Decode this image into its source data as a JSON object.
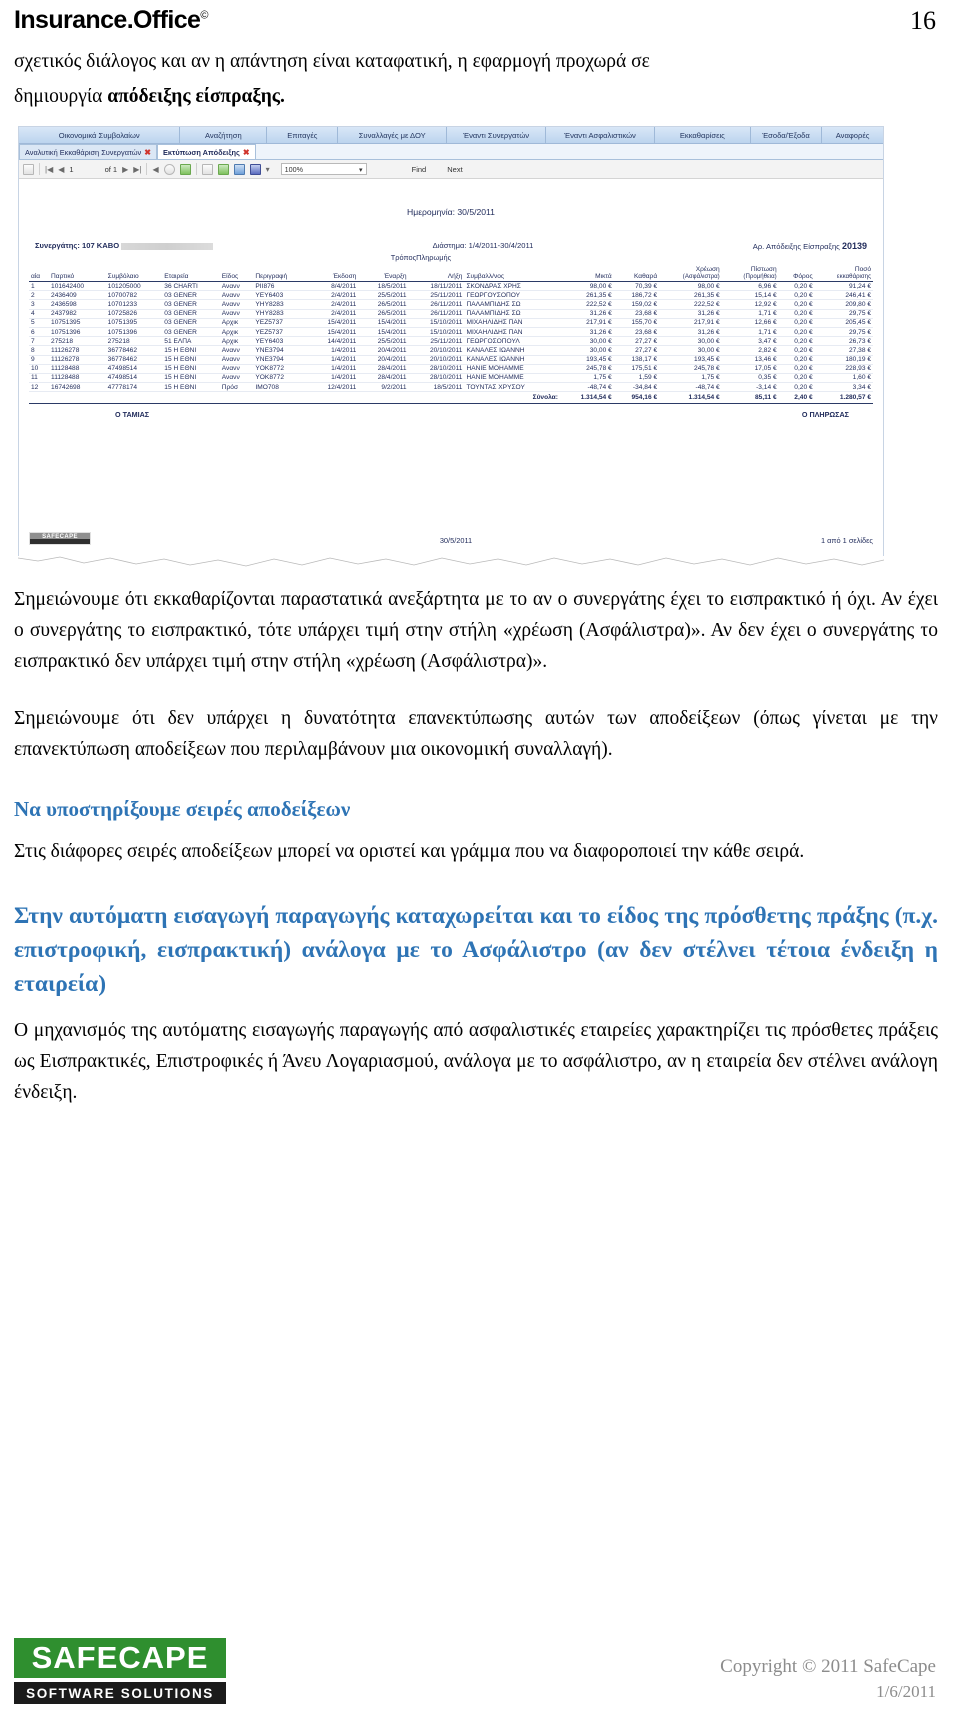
{
  "header": {
    "brand": "Insurance.Office",
    "brand_sup": "©",
    "page_number": "16"
  },
  "intro": {
    "line1": "σχετικός διάλογος και αν η απάντηση είναι καταφατική, η εφαρμογή προχωρά σε",
    "line2_prefix": "δημιουργία ",
    "line2_bold": "απόδειξης είσπραξης."
  },
  "screenshot": {
    "menu": [
      "Οικονομικά Συμβολαίων",
      "Αναζήτηση",
      "Επιταγές",
      "Συναλλαγές με ΔΟΥ",
      "Έναντι Συνεργατών",
      "Έναντι Ασφαλιστικών",
      "Εκκαθαρίσεις",
      "Έσοδα/Έξοδα",
      "Αναφορές"
    ],
    "subtabs": [
      {
        "label": "Αναλυτική Εκκαθάριση Συνεργατών",
        "close": "✖",
        "active": false
      },
      {
        "label": "Εκτύπωση Απόδειξης",
        "close": "✖",
        "active": true
      }
    ],
    "toolbar": {
      "page_current": "1",
      "page_of": "of 1",
      "zoom": "100%",
      "find": "Find",
      "next": "Next"
    },
    "report": {
      "date_label": "Ημερομηνία: 30/5/2011",
      "partner_label": "Συνεργάτης:",
      "partner_value": "107 ΚΑΒΟ",
      "period_label": "Διάστημα:",
      "period_value": "1/4/2011-30/4/2011",
      "receipt_label": "Αρ. Απόδειξης Είσπραξης",
      "receipt_number": "20139",
      "pay_method_label": "ΤρόποςΠληρωμής",
      "columns": [
        "αία",
        "Παρτικό",
        "Συμβόλαιο",
        "Εταιρεία",
        "Είδος",
        "Περιγραφή",
        "Έκδοση",
        "Έναρξη",
        "Λήξη",
        "Συμβαλλ/νος",
        "Μικτά",
        "Καθαρά",
        "Χρέωση",
        "Πίστωση",
        "Φόρος",
        "Ποσό"
      ],
      "columns_sub": {
        "xreosi": "(Ασφάλιστρα)",
        "pistosi": "(Προμήθεια)",
        "poso": "εκκαθάρισης"
      },
      "rows": [
        {
          "no": "1",
          "partiko": "101642400",
          "symvolaio": "101205000",
          "etairia": "36 CHARTI",
          "eidos": "Ανανν",
          "perigrafi": "PII876",
          "ekdosi": "8/4/2011",
          "enarxi": "18/5/2011",
          "lixi": "18/11/2011",
          "symvallomenos": "ΣΚΟΝΔΡΑΣ ΧΡΗΣ",
          "mikta": "98,00 €",
          "kathara": "70,39 €",
          "xreosi": "98,00 €",
          "pistosi": "6,96 €",
          "foros": "0,20 €",
          "poso": "91,24 €"
        },
        {
          "no": "2",
          "partiko": "2436409",
          "symvolaio": "10700782",
          "etairia": "03 GENER",
          "eidos": "Ανανν",
          "perigrafi": "YEY6403",
          "ekdosi": "2/4/2011",
          "enarxi": "25/5/2011",
          "lixi": "25/11/2011",
          "symvallomenos": "ΓΕΩΡΓΟΥΣΟΠΟΥ",
          "mikta": "261,35 €",
          "kathara": "186,72 €",
          "xreosi": "261,35 €",
          "pistosi": "15,14 €",
          "foros": "0,20 €",
          "poso": "246,41 €"
        },
        {
          "no": "3",
          "partiko": "2436598",
          "symvolaio": "10701233",
          "etairia": "03 GENER",
          "eidos": "Ανανν",
          "perigrafi": "YHY8283",
          "ekdosi": "2/4/2011",
          "enarxi": "26/5/2011",
          "lixi": "26/11/2011",
          "symvallomenos": "ΠΑΛΑΜΠΙΔΗΣ ΣΩ",
          "mikta": "222,52 €",
          "kathara": "159,02 €",
          "xreosi": "222,52 €",
          "pistosi": "12,92 €",
          "foros": "0,20 €",
          "poso": "209,80 €"
        },
        {
          "no": "4",
          "partiko": "2437982",
          "symvolaio": "10725826",
          "etairia": "03 GENER",
          "eidos": "Ανανν",
          "perigrafi": "YHY8283",
          "ekdosi": "2/4/2011",
          "enarxi": "26/5/2011",
          "lixi": "26/11/2011",
          "symvallomenos": "ΠΑΛΑΜΠΙΔΗΣ ΣΩ",
          "mikta": "31,26 €",
          "kathara": "23,68 €",
          "xreosi": "31,26 €",
          "pistosi": "1,71 €",
          "foros": "0,20 €",
          "poso": "29,75 €"
        },
        {
          "no": "5",
          "partiko": "10751395",
          "symvolaio": "10751395",
          "etairia": "03 GENER",
          "eidos": "Αρχικ",
          "perigrafi": "YEZ5737",
          "ekdosi": "15/4/2011",
          "enarxi": "15/4/2011",
          "lixi": "15/10/2011",
          "symvallomenos": "ΜΙΧΑΗΛΙΔΗΣ ΠΑΝ",
          "mikta": "217,91 €",
          "kathara": "155,70 €",
          "xreosi": "217,91 €",
          "pistosi": "12,66 €",
          "foros": "0,20 €",
          "poso": "205,45 €"
        },
        {
          "no": "6",
          "partiko": "10751396",
          "symvolaio": "10751396",
          "etairia": "03 GENER",
          "eidos": "Αρχικ",
          "perigrafi": "YEZ5737",
          "ekdosi": "15/4/2011",
          "enarxi": "15/4/2011",
          "lixi": "15/10/2011",
          "symvallomenos": "ΜΙΧΑΗΛΙΔΗΣ ΠΑΝ",
          "mikta": "31,26 €",
          "kathara": "23,68 €",
          "xreosi": "31,26 €",
          "pistosi": "1,71 €",
          "foros": "0,20 €",
          "poso": "29,75 €"
        },
        {
          "no": "7",
          "partiko": "275218",
          "symvolaio": "275218",
          "etairia": "51 ΕΛΠΑ",
          "eidos": "Αρχικ",
          "perigrafi": "YEY6403",
          "ekdosi": "14/4/2011",
          "enarxi": "25/5/2011",
          "lixi": "25/11/2011",
          "symvallomenos": "ΓΕΩΡΓΟΣΟΠΟΥΛ",
          "mikta": "30,00 €",
          "kathara": "27,27 €",
          "xreosi": "30,00 €",
          "pistosi": "3,47 €",
          "foros": "0,20 €",
          "poso": "26,73 €"
        },
        {
          "no": "8",
          "partiko": "11126278",
          "symvolaio": "36778462",
          "etairia": "15 Η ΕΘΝΙ",
          "eidos": "Ανανν",
          "perigrafi": "YNE3794",
          "ekdosi": "1/4/2011",
          "enarxi": "20/4/2011",
          "lixi": "20/10/2011",
          "symvallomenos": "ΚΑΝΑΛΕΣ ΙΩΑΝΝΗ",
          "mikta": "30,00 €",
          "kathara": "27,27 €",
          "xreosi": "30,00 €",
          "pistosi": "2,82 €",
          "foros": "0,20 €",
          "poso": "27,38 €"
        },
        {
          "no": "9",
          "partiko": "11126278",
          "symvolaio": "36778462",
          "etairia": "15 Η ΕΘΝΙ",
          "eidos": "Ανανν",
          "perigrafi": "YNE3794",
          "ekdosi": "1/4/2011",
          "enarxi": "20/4/2011",
          "lixi": "20/10/2011",
          "symvallomenos": "ΚΑΝΑΛΕΣ ΙΩΑΝΝΗ",
          "mikta": "193,45 €",
          "kathara": "138,17 €",
          "xreosi": "193,45 €",
          "pistosi": "13,46 €",
          "foros": "0,20 €",
          "poso": "180,19 €"
        },
        {
          "no": "10",
          "partiko": "11128488",
          "symvolaio": "47498514",
          "etairia": "15 Η ΕΘΝΙ",
          "eidos": "Ανανν",
          "perigrafi": "YOK8772",
          "ekdosi": "1/4/2011",
          "enarxi": "28/4/2011",
          "lixi": "28/10/2011",
          "symvallomenos": "ΗΑΝΙΕ ΜΟΗΑΜΜΕ",
          "mikta": "245,78 €",
          "kathara": "175,51 €",
          "xreosi": "245,78 €",
          "pistosi": "17,05 €",
          "foros": "0,20 €",
          "poso": "228,93 €"
        },
        {
          "no": "11",
          "partiko": "11128488",
          "symvolaio": "47498514",
          "etairia": "15 Η ΕΘΝΙ",
          "eidos": "Ανανν",
          "perigrafi": "YOK8772",
          "ekdosi": "1/4/2011",
          "enarxi": "28/4/2011",
          "lixi": "28/10/2011",
          "symvallomenos": "ΗΑΝΙΕ ΜΟΗΑΜΜΕ",
          "mikta": "1,75 €",
          "kathara": "1,59 €",
          "xreosi": "1,75 €",
          "pistosi": "0,35 €",
          "foros": "0,20 €",
          "poso": "1,60 €"
        },
        {
          "no": "12",
          "partiko": "16742698",
          "symvolaio": "47778174",
          "etairia": "15 Η ΕΘΝΙ",
          "eidos": "Πρόσ",
          "perigrafi": "IMO708",
          "ekdosi": "12/4/2011",
          "enarxi": "9/2/2011",
          "lixi": "18/5/2011",
          "symvallomenos": "ΤΟΥΝΤΑΣ ΧΡΥΣΟΥ",
          "mikta": "-48,74 €",
          "kathara": "-34,84 €",
          "xreosi": "-48,74 €",
          "pistosi": "-3,14 €",
          "foros": "0,20 €",
          "poso": "3,34 €"
        }
      ],
      "totals": {
        "label": "Σύνολα:",
        "mikta": "1.314,54 €",
        "kathara": "954,16 €",
        "xreosi": "1.314,54 €",
        "pistosi": "85,11 €",
        "foros": "2,40 €",
        "poso": "1.280,57 €"
      },
      "signature_left": "Ο ΤΑΜΙΑΣ",
      "signature_right": "Ο ΠΛΗΡΩΣΑΣ",
      "footer_date": "30/5/2011",
      "footer_pages": "1 από 1 σελίδες",
      "footer_logo_top": "SAFECAPE",
      "footer_logo_bottom": ""
    }
  },
  "body": {
    "p1": "Σημειώνουμε ότι εκκαθαρίζονται παραστατικά ανεξάρτητα με το αν ο συνεργάτης έχει το εισπρακτικό ή όχι. Αν έχει ο συνεργάτης το εισπρακτικό, τότε υπάρχει τιμή στην στήλη «χρέωση (Ασφάλιστρα)». Αν δεν έχει ο συνεργάτης το εισπρακτικό δεν υπάρχει τιμή στην στήλη «χρέωση (Ασφάλιστρα)».",
    "p2": "Σημειώνουμε ότι δεν υπάρχει η δυνατότητα επανεκτύπωσης αυτών των αποδείξεων (όπως γίνεται με την επανεκτύπωση αποδείξεων που περιλαμβάνουν μια οικονομική συναλλαγή).",
    "h1": "Να υποστηρίξουμε σειρές αποδείξεων",
    "p3": "Στις διάφορες σειρές αποδείξεων μπορεί να οριστεί και γράμμα που να διαφοροποιεί την κάθε σειρά.",
    "h2": "Στην αυτόματη εισαγωγή παραγωγής καταχωρείται και το είδος της πρόσθετης πράξης (π.χ. επιστροφική, εισπρακτική) ανάλογα με το Ασφάλιστρο (αν δεν στέλνει τέτοια ένδειξη η εταιρεία)",
    "p4": "Ο μηχανισμός της αυτόματης εισαγωγής παραγωγής από ασφαλιστικές εταιρείες χαρακτηρίζει τις πρόσθετες πράξεις ως Εισπρακτικές, Επιστροφικές ή Άνευ Λογαριασμού, ανάλογα με το ασφάλιστρο, αν η εταιρεία δεν στέλνει ανάλογη ένδειξη."
  },
  "footer": {
    "logo_top": "SAFECAPE",
    "logo_bottom": "SOFTWARE SOLUTIONS",
    "copyright": "Copyright © 2011 SafeCape",
    "date": "1/6/2011"
  }
}
